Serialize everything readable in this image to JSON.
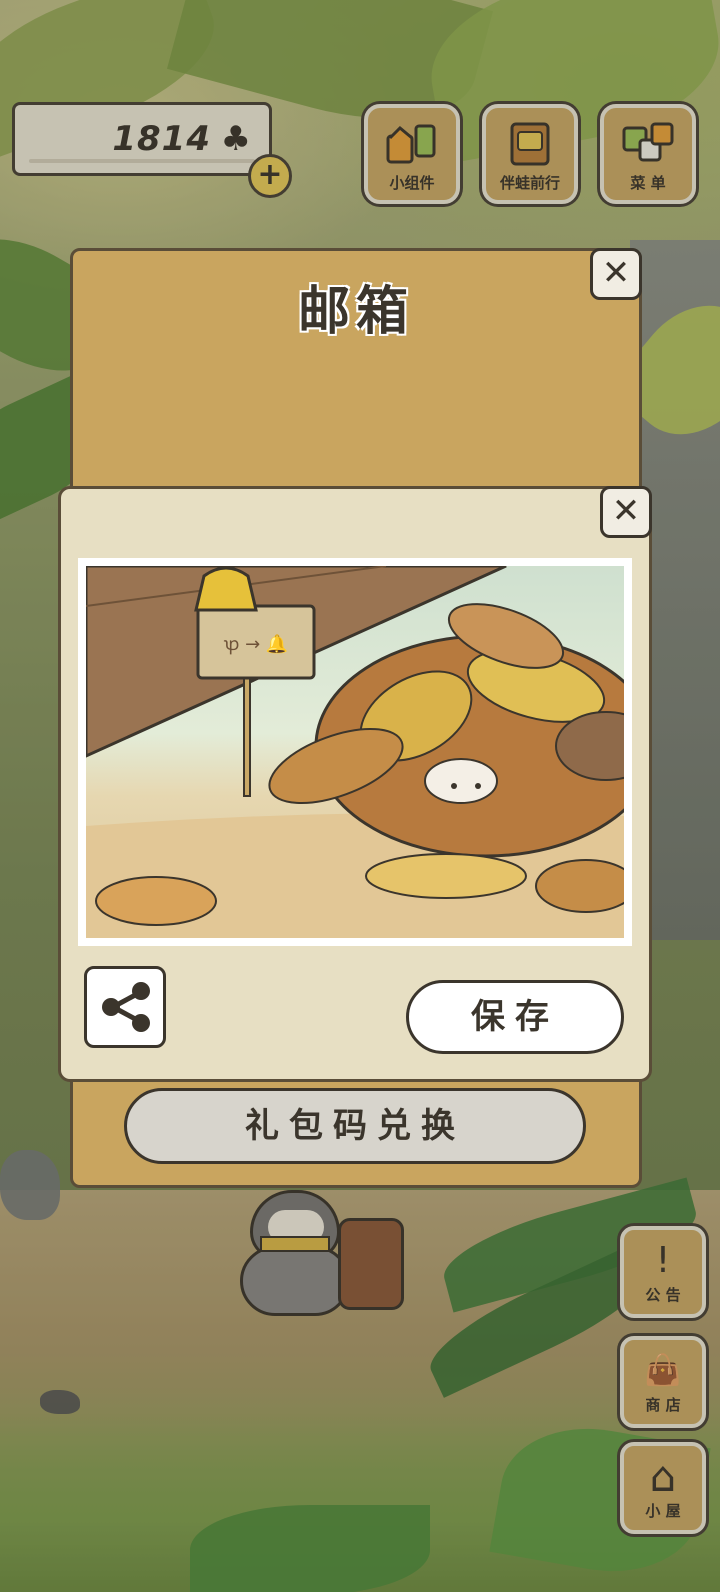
{
  "hud": {
    "clover_count": "1814",
    "clover_symbol": "♣",
    "plus_label": "+",
    "buttons": [
      {
        "label": "小组件",
        "icon": "widget-icon"
      },
      {
        "label": "伴蛙前行",
        "icon": "journey-icon"
      },
      {
        "label": "菜 单",
        "icon": "menu-icon"
      }
    ],
    "side_buttons": [
      {
        "label": "公 告",
        "icon": "announcement-icon",
        "glyph": "!"
      },
      {
        "label": "商 店",
        "icon": "shop-bag-icon",
        "glyph": "👜"
      },
      {
        "label": "小 屋",
        "icon": "house-icon",
        "glyph": "⌂"
      }
    ]
  },
  "mailbox": {
    "title": "邮箱",
    "close": "✕",
    "redeem_label": "礼包码兑换"
  },
  "photo_popup": {
    "close": "✕",
    "save_label": "保存",
    "share_icon": "share-icon",
    "sign_text": "ꝕ → 🔔"
  },
  "colors": {
    "panel": "#c9a55f",
    "card": "#e7dfc3",
    "outline": "#3b352c",
    "hud_button": "#c9a866"
  }
}
